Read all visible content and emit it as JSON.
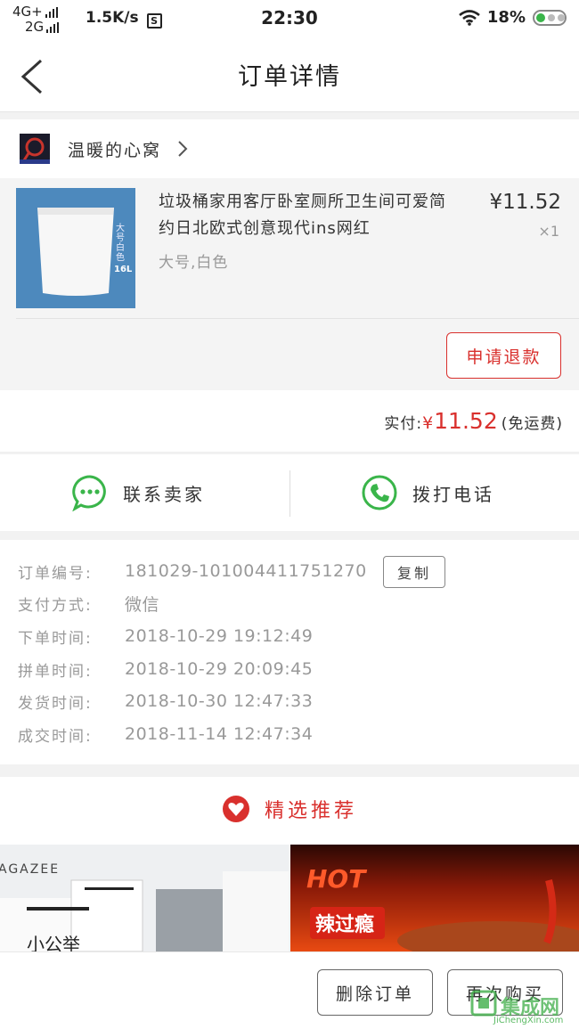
{
  "status_bar": {
    "network_top": "4G+",
    "network_bottom": "2G",
    "speed": "1.5K/s",
    "speed_box": "S",
    "time": "22:30",
    "battery": "18%"
  },
  "nav": {
    "title": "订单详情"
  },
  "shop": {
    "name": "温暖的心窝"
  },
  "product": {
    "title": "垃圾桶家用客厅卧室厕所卫生间可爱简约日北欧式创意现代ins网红",
    "spec": "大号,白色",
    "price": "¥11.52",
    "qty": "×1",
    "image_caption": "大号白色",
    "image_size": "16L",
    "refund_label": "申请退款"
  },
  "payment": {
    "label": "实付:",
    "currency": "¥",
    "amount": "11.52",
    "note": "(免运费)"
  },
  "contact": {
    "seller_label": "联系卖家",
    "phone_label": "拨打电话"
  },
  "order_info": {
    "copy_label": "复制",
    "rows": [
      {
        "label": "订单编号:",
        "value": "181029-101004411751270"
      },
      {
        "label": "支付方式:",
        "value": "微信"
      },
      {
        "label": "下单时间:",
        "value": "2018-10-29 19:12:49"
      },
      {
        "label": "拼单时间:",
        "value": "2018-10-29 20:09:45"
      },
      {
        "label": "发货时间:",
        "value": "2018-10-30 12:47:33"
      },
      {
        "label": "成交时间:",
        "value": "2018-11-14 12:47:34"
      }
    ]
  },
  "recommend": {
    "title": "精选推荐",
    "left_image_text_1": "AGAZEE",
    "left_image_text_2": "小公举",
    "right_image_text_1": "HOT",
    "right_image_text_2": "辣过瘾"
  },
  "bottom": {
    "delete_label": "删除订单",
    "rebuy_label": "再次购买"
  },
  "watermark": {
    "text": "集成网",
    "sub": "JiChengXin.com"
  },
  "colors": {
    "accent_red": "#d9302d",
    "wechat_green": "#3ab54a"
  }
}
